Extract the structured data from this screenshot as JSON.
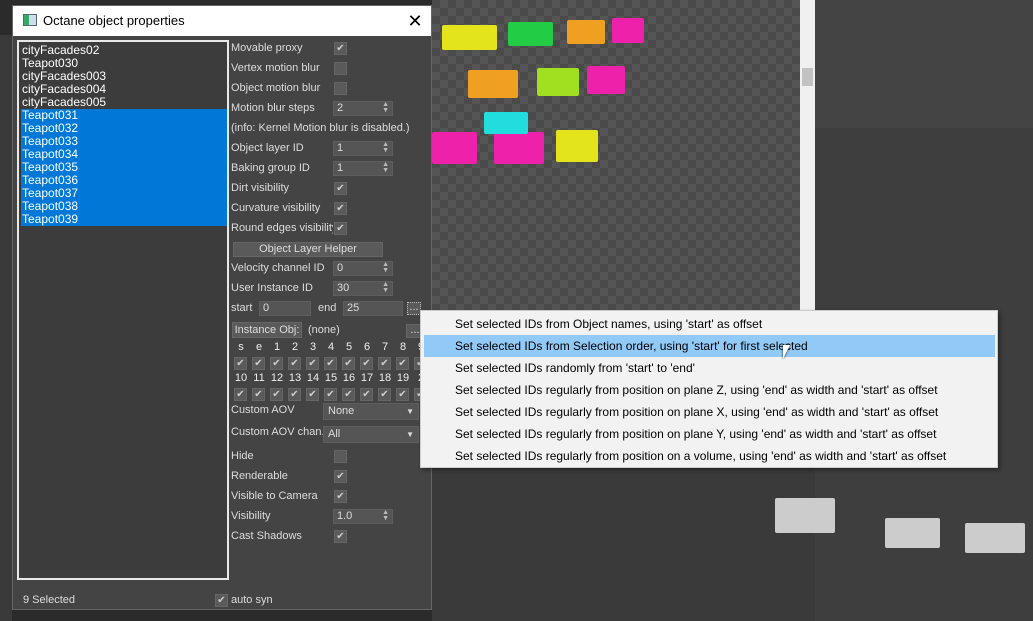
{
  "dialog": {
    "title": "Octane object properties",
    "close": "✕"
  },
  "objects": [
    {
      "name": "cityFacades02",
      "selected": false
    },
    {
      "name": "Teapot030",
      "selected": false
    },
    {
      "name": "cityFacades003",
      "selected": false
    },
    {
      "name": "cityFacades004",
      "selected": false
    },
    {
      "name": "cityFacades005",
      "selected": false
    },
    {
      "name": "Teapot031",
      "selected": true
    },
    {
      "name": "Teapot032",
      "selected": true
    },
    {
      "name": "Teapot033",
      "selected": true
    },
    {
      "name": "Teapot034",
      "selected": true
    },
    {
      "name": "Teapot035",
      "selected": true
    },
    {
      "name": "Teapot036",
      "selected": true
    },
    {
      "name": "Teapot037",
      "selected": true
    },
    {
      "name": "Teapot038",
      "selected": true
    },
    {
      "name": "Teapot039",
      "selected": true
    }
  ],
  "props": {
    "movable_proxy": {
      "label": "Movable proxy",
      "checked": true
    },
    "vertex_motion_blur": {
      "label": "Vertex motion blur",
      "checked": false
    },
    "object_motion_blur": {
      "label": "Object motion blur",
      "checked": false
    },
    "motion_blur_steps": {
      "label": "Motion blur steps",
      "value": "2"
    },
    "info": "(info: Kernel Motion blur is disabled.)",
    "object_layer_id": {
      "label": "Object layer ID",
      "value": "1"
    },
    "baking_group_id": {
      "label": "Baking group ID",
      "value": "1"
    },
    "dirt_visibility": {
      "label": "Dirt visibility",
      "checked": true
    },
    "curvature_visibility": {
      "label": "Curvature visibility",
      "checked": true
    },
    "round_edges_visibility": {
      "label": "Round edges visibility",
      "checked": true
    },
    "object_layer_helper": "Object Layer Helper",
    "velocity_channel_id": {
      "label": "Velocity channel ID",
      "value": "0"
    },
    "user_instance_id": {
      "label": "User Instance ID",
      "value": "30"
    },
    "start": {
      "label": "start",
      "value": "0"
    },
    "end": {
      "label": "end",
      "value": "25"
    },
    "more_button": "...",
    "instance_obj": {
      "label": "Instance Obj:",
      "value": "(none)",
      "button": "..."
    },
    "grid_row1": [
      "s",
      "e",
      "1",
      "2",
      "3",
      "4",
      "5",
      "6",
      "7",
      "8",
      "9"
    ],
    "grid_row2": [
      "10",
      "11",
      "12",
      "13",
      "14",
      "15",
      "16",
      "17",
      "18",
      "19",
      "2"
    ],
    "custom_aov": {
      "label": "Custom AOV",
      "value": "None"
    },
    "custom_aov_chan": {
      "label": "Custom AOV chan.",
      "value": "All"
    },
    "hide": {
      "label": "Hide",
      "checked": false
    },
    "renderable": {
      "label": "Renderable",
      "checked": true
    },
    "visible_to_camera": {
      "label": "Visible to Camera",
      "checked": true
    },
    "visibility": {
      "label": "Visibility",
      "value": "1.0"
    },
    "cast_shadows": {
      "label": "Cast Shadows",
      "checked": true
    }
  },
  "footer": {
    "status": "9 Selected",
    "auto_sync": "auto syn",
    "auto_sync_checked": true
  },
  "menu": {
    "highlighted": 1,
    "items": [
      "Set selected IDs from Object names, using 'start' as offset",
      "Set selected IDs from Selection order, using 'start' for first selected",
      "Set selected IDs randomly from 'start' to 'end'",
      "Set selected IDs regularly from position on plane Z, using 'end' as width and 'start' as offset",
      "Set selected IDs regularly from position on plane X, using 'end' as width and 'start' as offset",
      "Set selected IDs regularly from position on plane Y, using 'end' as width and 'start' as offset",
      "Set selected IDs regularly from position on a volume, using 'end' as width and 'start' as offset"
    ]
  }
}
